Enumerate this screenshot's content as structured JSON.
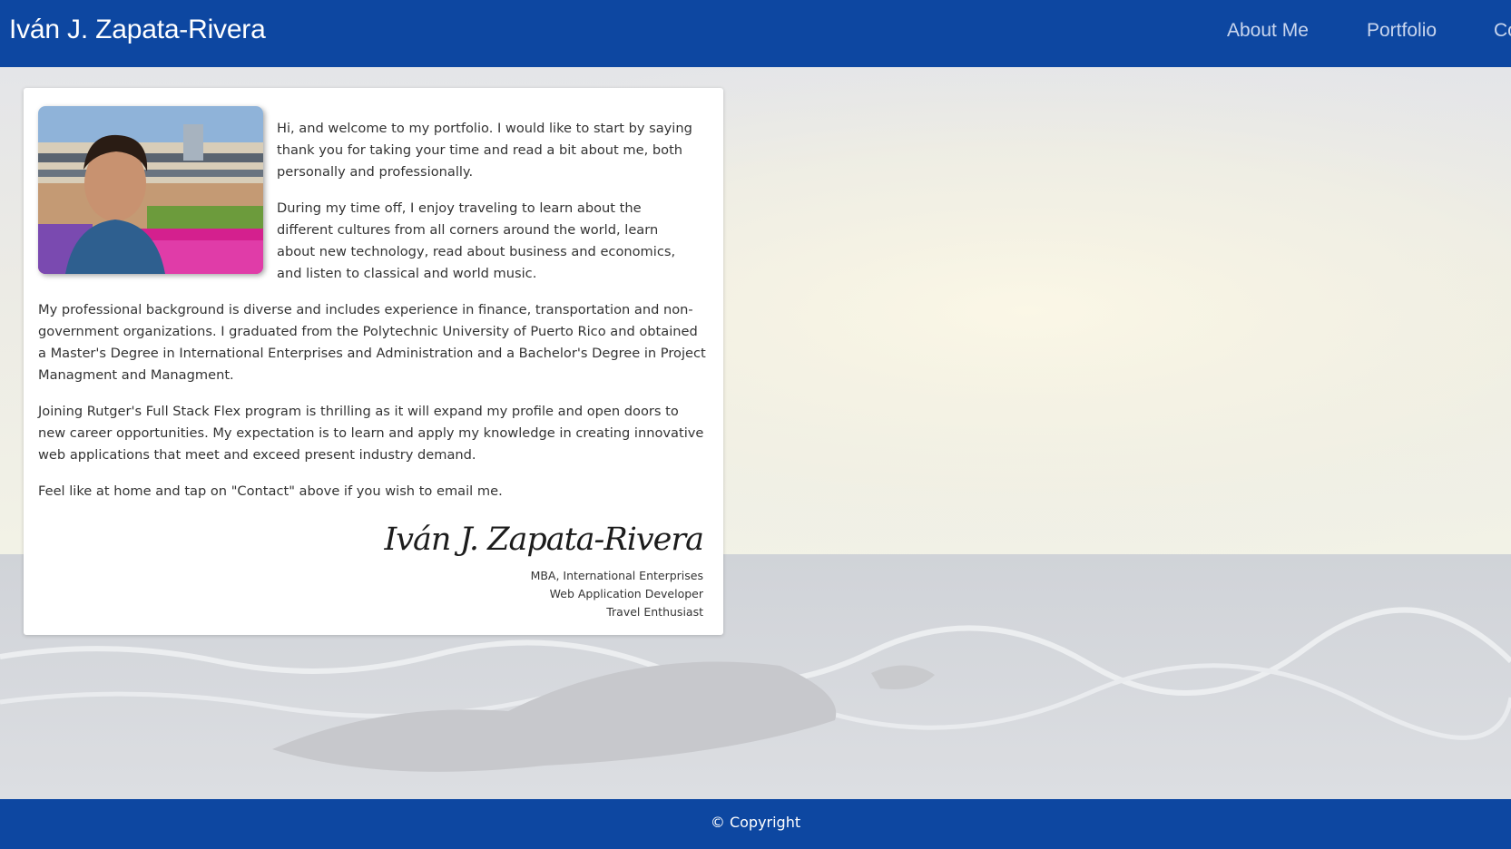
{
  "header": {
    "brand": "Iván J. Zapata-Rivera",
    "nav": {
      "about": "About Me",
      "portfolio": "Portfolio",
      "contact": "Co"
    }
  },
  "about": {
    "paragraphs": [
      "Hi, and welcome to my portfolio. I would like to start by saying thank you for taking your time and read a bit about me, both personally and professionally.",
      "During my time off, I enjoy traveling to learn about the different cultures from all corners around the world, learn about new technology, read about business and economics, and listen to classical and world music.",
      "My professional background is diverse and includes experience in finance, transportation and non-government organizations. I graduated from the Polytechnic University of Puerto Rico and obtained a Master's Degree in International Enterprises and Administration and a Bachelor's Degree in Project Managment and Managment.",
      "Joining Rutger's Full Stack Flex program is thrilling as it will expand my profile and open doors to new career opportunities. My expectation is to learn and apply my knowledge in creating innovative web applications that meet and exceed present industry demand.",
      "Feel like at home and tap on \"Contact\" above if you wish to email me."
    ],
    "signature": "Iván J. Zapata-Rivera",
    "titles": [
      "MBA, International Enterprises",
      "Web Application Developer",
      "Travel Enthusiast"
    ]
  },
  "footer": {
    "copyright": "© Copyright"
  },
  "colors": {
    "header_bg": "#0d47a1",
    "nav_link": "#c9d6ee",
    "card_bg": "#ffffff"
  }
}
